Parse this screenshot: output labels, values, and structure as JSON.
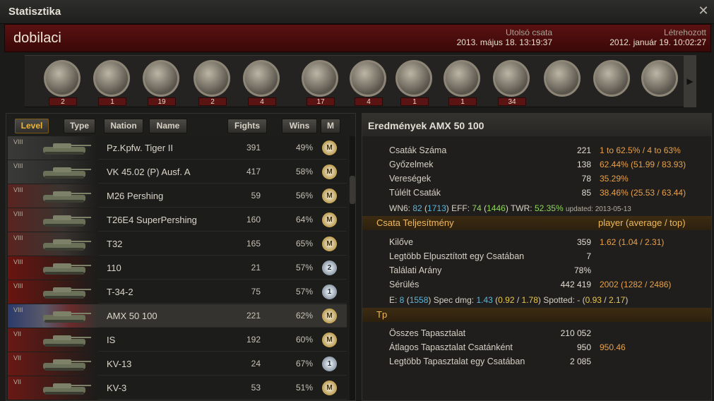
{
  "window": {
    "title": "Statisztika",
    "close_glyph": "✕"
  },
  "player": {
    "name": "dobilaci",
    "last_battle_label": "Utolsó csata",
    "last_battle_value": "2013. május 18. 13:19:37",
    "created_label": "Létrehozott",
    "created_value": "2012. január 19. 10:02:27"
  },
  "medals": [
    {
      "icon": "medal-tank-shield-icon",
      "count": "2"
    },
    {
      "icon": "medal-red-banner-icon",
      "count": "1"
    },
    {
      "icon": "medal-laurel-target-icon",
      "count": "19"
    },
    {
      "icon": "medal-laurel-tanks-icon",
      "count": "2"
    },
    {
      "icon": "medal-wot-emblem-icon",
      "count": "4"
    },
    {
      "icon": "medal-green-ribbon-icon",
      "count": "17"
    },
    {
      "icon": "medal-red-ribbon-icon",
      "count": "4"
    },
    {
      "icon": "medal-red-diamond-icon",
      "count": "1"
    },
    {
      "icon": "medal-tank-crest-icon",
      "count": "1"
    },
    {
      "icon": "medal-blue-ribbon-icon",
      "count": "34"
    },
    {
      "icon": "medal-portrait-bronze-icon",
      "count": ""
    },
    {
      "icon": "medal-portrait-cross-icon",
      "count": ""
    },
    {
      "icon": "medal-portrait-star-icon",
      "count": ""
    }
  ],
  "list_headers": {
    "level": "Level",
    "type": "Type",
    "nation": "Nation",
    "name": "Name",
    "fights": "Fights",
    "wins": "Wins",
    "mastery": "M"
  },
  "vehicles": [
    {
      "tier": "VIII",
      "nation": "germany",
      "name": "Pz.Kpfw. Tiger II",
      "fights": "391",
      "wins": "49%",
      "mastery": "M",
      "mastery_type": "gold"
    },
    {
      "tier": "VIII",
      "nation": "germany",
      "name": "VK 45.02 (P) Ausf. A",
      "fights": "417",
      "wins": "58%",
      "mastery": "M",
      "mastery_type": "gold"
    },
    {
      "tier": "VIII",
      "nation": "usa",
      "name": "M26 Pershing",
      "fights": "59",
      "wins": "56%",
      "mastery": "M",
      "mastery_type": "gold"
    },
    {
      "tier": "VIII",
      "nation": "usa",
      "name": "T26E4 SuperPershing",
      "fights": "160",
      "wins": "64%",
      "mastery": "M",
      "mastery_type": "gold"
    },
    {
      "tier": "VIII",
      "nation": "usa",
      "name": "T32",
      "fights": "165",
      "wins": "65%",
      "mastery": "M",
      "mastery_type": "gold"
    },
    {
      "tier": "VIII",
      "nation": "china",
      "name": "110",
      "fights": "21",
      "wins": "57%",
      "mastery": "2",
      "mastery_type": "silver"
    },
    {
      "tier": "VIII",
      "nation": "china",
      "name": "T-34-2",
      "fights": "75",
      "wins": "57%",
      "mastery": "1",
      "mastery_type": "silver"
    },
    {
      "tier": "VIII",
      "nation": "france",
      "name": "AMX 50 100",
      "fights": "221",
      "wins": "62%",
      "mastery": "M",
      "mastery_type": "gold"
    },
    {
      "tier": "VII",
      "nation": "ussr",
      "name": "IS",
      "fights": "192",
      "wins": "60%",
      "mastery": "M",
      "mastery_type": "gold"
    },
    {
      "tier": "VII",
      "nation": "ussr",
      "name": "KV-13",
      "fights": "24",
      "wins": "67%",
      "mastery": "1",
      "mastery_type": "silver"
    },
    {
      "tier": "VII",
      "nation": "ussr",
      "name": "KV-3",
      "fights": "53",
      "wins": "51%",
      "mastery": "M",
      "mastery_type": "gold"
    }
  ],
  "detail": {
    "title": "Eredmények AMX 50 100",
    "battles": [
      {
        "label": "Csaták Száma",
        "value": "221",
        "extra": "1 to 62.5% / 4 to 63%"
      },
      {
        "label": "Győzelmek",
        "value": "138",
        "extra": "62.44% (51.99 / 83.93)"
      },
      {
        "label": "Vereségek",
        "value": "78",
        "extra": "35.29%"
      },
      {
        "label": "Túlélt Csaták",
        "value": "85",
        "extra": "38.46% (25.53 / 63.44)"
      }
    ],
    "wn6": {
      "l1": "WN6:",
      "v1": "82",
      "o1": " (",
      "v2": "1713",
      "c1": ") EFF: ",
      "v3": "74",
      "o2": " (",
      "v4": "1446",
      "c2": ") TWR: ",
      "v5": "52.35%",
      "upd": "updated: 2013-05-13"
    },
    "perf_section": {
      "title": "Csata Teljesítmény",
      "right": "player (average / top)"
    },
    "perf": [
      {
        "label": "Kilőve",
        "value": "359",
        "extra": "1.62 (1.04 / 2.31)"
      },
      {
        "label": "Legtöbb Elpusztított egy Csatában",
        "value": "7",
        "extra": ""
      },
      {
        "label": "Találati Arány",
        "value": "78%",
        "extra": ""
      },
      {
        "label": "Sérülés",
        "value": "442 419",
        "extra": "2002 (1282 / 2486)"
      }
    ],
    "eline": {
      "l1": "E: ",
      "v1": "8",
      "o1": " (",
      "v2": "1558",
      "c1": ")  Spec dmg: ",
      "v3": "1.43",
      "o2": " (",
      "v4": "0.92",
      "s1": " / ",
      "v5": "1.78",
      "c2": ")  Spotted: - (",
      "v6": "0.93",
      "s2": " / ",
      "v7": "2.17",
      "c3": ")"
    },
    "tp_section": {
      "title": "Tp"
    },
    "tp": [
      {
        "label": "Összes Tapasztalat",
        "value": "210 052",
        "extra": ""
      },
      {
        "label": "Átlagos Tapasztalat Csatánként",
        "value": "950",
        "extra": "950.46"
      },
      {
        "label": "Legtöbb Tapasztalat egy Csatában",
        "value": "2 085",
        "extra": ""
      }
    ]
  }
}
